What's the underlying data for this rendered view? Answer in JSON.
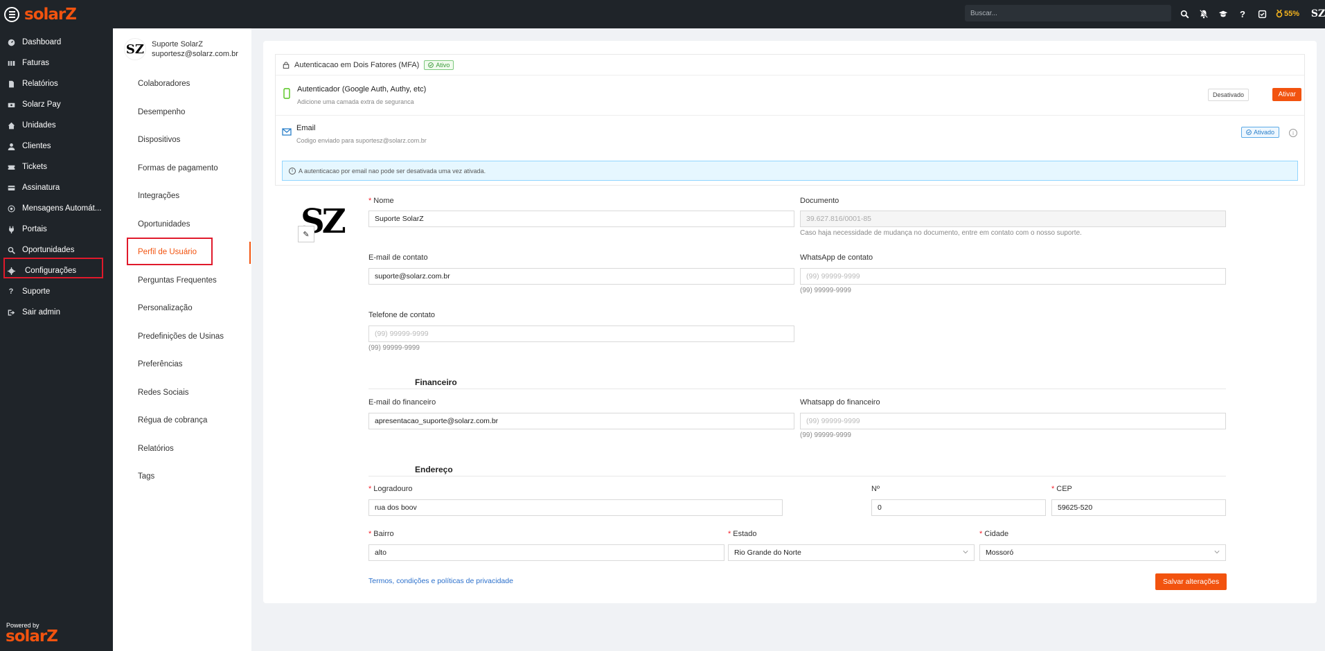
{
  "topbar": {
    "logo": "solarZ",
    "search_placeholder": "Buscar...",
    "progress_label": "55%",
    "progress_value": 55
  },
  "sidebar": {
    "items": [
      {
        "label": "Dashboard",
        "icon": "gauge-icon"
      },
      {
        "label": "Faturas",
        "icon": "bars-icon"
      },
      {
        "label": "Relatórios",
        "icon": "document-icon"
      },
      {
        "label": "Solarz Pay",
        "icon": "payment-icon"
      },
      {
        "label": "Unidades",
        "icon": "home-icon"
      },
      {
        "label": "Clientes",
        "icon": "user-icon"
      },
      {
        "label": "Tickets",
        "icon": "ticket-icon"
      },
      {
        "label": "Assinatura",
        "icon": "card-icon"
      },
      {
        "label": "Mensagens Automát...",
        "icon": "whatsapp-icon"
      },
      {
        "label": "Portais",
        "icon": "plug-icon"
      },
      {
        "label": "Oportunidades",
        "icon": "search-icon"
      },
      {
        "label": "Configurações",
        "icon": "gear-icon"
      },
      {
        "label": "Suporte",
        "icon": "question-icon"
      },
      {
        "label": "Sair admin",
        "icon": "logout-icon"
      }
    ],
    "powered_by": "Powered by",
    "footer_logo": "solarZ"
  },
  "settings": {
    "user_name": "Suporte SolarZ",
    "user_email": "suportesz@solarz.com.br",
    "items": [
      "Colaboradores",
      "Desempenho",
      "Dispositivos",
      "Formas de pagamento",
      "Integrações",
      "Oportunidades",
      "Perfil de Usuário",
      "Perguntas Frequentes",
      "Personalização",
      "Predefinições de Usinas",
      "Preferências",
      "Redes Sociais",
      "Régua de cobrança",
      "Relatórios",
      "Tags"
    ],
    "active_index": 6
  },
  "mfa": {
    "title": "Autenticacao em Dois Fatores (MFA)",
    "status": "Ativo",
    "authenticator_title": "Autenticador (Google Auth, Authy, etc)",
    "authenticator_sub": "Adicione uma camada extra de seguranca",
    "authenticator_status": "Desativado",
    "activate_label": "Ativar",
    "email_title": "Email",
    "email_sub": "Codigo enviado para suportesz@solarz.com.br",
    "email_status": "Ativado",
    "alert": "A autenticacao por email nao pode ser desativada uma vez ativada."
  },
  "form": {
    "nome_label": "Nome",
    "nome_value": "Suporte SolarZ",
    "documento_label": "Documento",
    "documento_value": "39.627.816/0001-85",
    "documento_hint": "Caso haja necessidade de mudança no documento, entre em contato com o nosso suporte.",
    "email_contato_label": "E-mail de contato",
    "email_contato_value": "suporte@solarz.com.br",
    "whatsapp_contato_label": "WhatsApp de contato",
    "whatsapp_placeholder": "(99) 99999-9999",
    "whatsapp_hint": "(99) 99999-9999",
    "telefone_label": "Telefone de contato",
    "telefone_placeholder": "(99) 99999-9999",
    "telefone_hint": "(99) 99999-9999",
    "financeiro_title": "Financeiro",
    "email_fin_label": "E-mail do financeiro",
    "email_fin_value": "apresentacao_suporte@solarz.com.br",
    "whats_fin_label": "Whatsapp do financeiro",
    "whats_fin_placeholder": "(99) 99999-9999",
    "whats_fin_hint": "(99) 99999-9999",
    "endereco_title": "Endereço",
    "logradouro_label": "Logradouro",
    "logradouro_value": "rua dos boov",
    "numero_label": "Nº",
    "numero_value": "0",
    "cep_label": "CEP",
    "cep_value": "59625-520",
    "bairro_label": "Bairro",
    "bairro_value": "alto",
    "estado_label": "Estado",
    "estado_value": "Rio Grande do Norte",
    "cidade_label": "Cidade",
    "cidade_value": "Mossoró",
    "terms_link": "Termos, condições e políticas de privacidade",
    "save_label": "Salvar alterações"
  },
  "colors": {
    "accent": "#f2530f",
    "sidebar_bg": "#1f2429",
    "highlight_box": "#e0192b"
  }
}
